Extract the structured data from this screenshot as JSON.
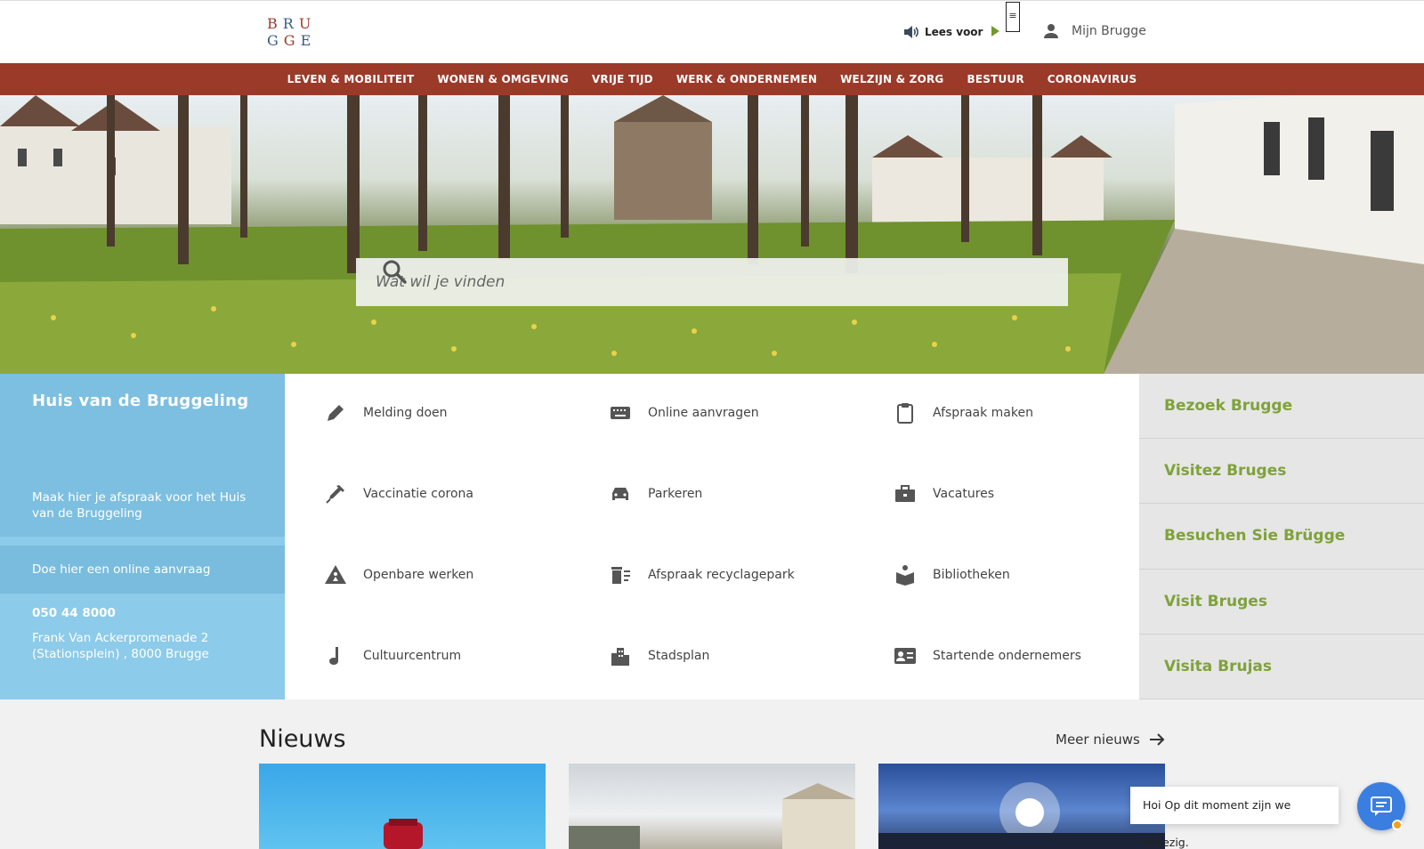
{
  "header": {
    "logo_line1": [
      "B",
      "R",
      "U"
    ],
    "logo_line2": [
      "G",
      "G",
      "E"
    ],
    "read_aloud_label": "Lees voor",
    "user_label": "Mijn Brugge"
  },
  "nav": {
    "items": [
      {
        "label": "LEVEN & MOBILITEIT"
      },
      {
        "label": "WONEN & OMGEVING"
      },
      {
        "label": "VRIJE TIJD"
      },
      {
        "label": "WERK & ONDERNEMEN"
      },
      {
        "label": "WELZIJN & ZORG"
      },
      {
        "label": "BESTUUR"
      },
      {
        "label": "CORONAVIRUS"
      }
    ]
  },
  "search": {
    "placeholder": "Wat wil je vinden"
  },
  "huis": {
    "title": "Huis van de Bruggeling",
    "appointment": "Maak hier je afspraak voor het Huis van de Bruggeling",
    "online": "Doe hier een online aanvraag",
    "phone": "050 44 8000",
    "address": "Frank Van Ackerpromenade 2 (Stationsplein) , 8000 Brugge"
  },
  "quick_links": [
    {
      "label": "Melding doen",
      "icon": "pencil-icon"
    },
    {
      "label": "Online aanvragen",
      "icon": "keyboard-icon"
    },
    {
      "label": "Afspraak maken",
      "icon": "clipboard-icon"
    },
    {
      "label": "Vaccinatie corona",
      "icon": "syringe-icon"
    },
    {
      "label": "Parkeren",
      "icon": "car-icon"
    },
    {
      "label": "Vacatures",
      "icon": "briefcase-icon"
    },
    {
      "label": "Openbare werken",
      "icon": "roadwork-icon"
    },
    {
      "label": "Afspraak recyclagepark",
      "icon": "recycle-bin-icon"
    },
    {
      "label": "Bibliotheken",
      "icon": "book-reader-icon"
    },
    {
      "label": "Cultuurcentrum",
      "icon": "music-note-icon"
    },
    {
      "label": "Stadsplan",
      "icon": "city-icon"
    },
    {
      "label": "Startende ondernemers",
      "icon": "id-card-icon"
    }
  ],
  "visit": [
    {
      "label": "Bezoek Brugge"
    },
    {
      "label": "Visitez Bruges"
    },
    {
      "label": "Besuchen Sie Brügge"
    },
    {
      "label": "Visit Bruges"
    },
    {
      "label": "Visita Brujas"
    }
  ],
  "news": {
    "title": "Nieuws",
    "more": "Meer nieuws"
  },
  "chat": {
    "message": "Hoi Op dit moment zijn we afwezig."
  },
  "colors": {
    "nav_bg": "#9c3a2a",
    "huis_bg": "#8ccbe9",
    "visit_text": "#7fa23a",
    "chat_button": "#3a7ee0"
  }
}
